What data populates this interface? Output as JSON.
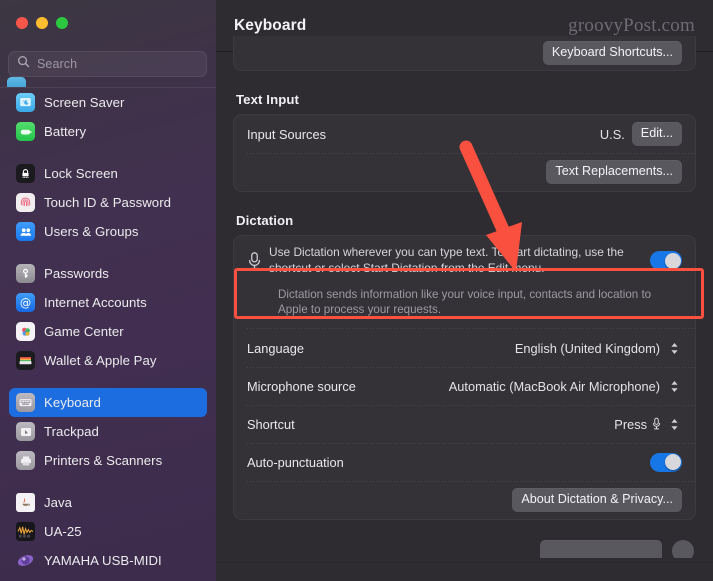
{
  "window": {
    "traffic_lights": [
      "close",
      "minimize",
      "zoom"
    ],
    "watermark": "groovyPost.com"
  },
  "sidebar": {
    "search": {
      "placeholder": "Search",
      "value": ""
    },
    "groups": [
      {
        "items": [
          {
            "label": "Screen Saver",
            "icon": "screen-saver-icon"
          },
          {
            "label": "Battery",
            "icon": "battery-icon"
          }
        ]
      },
      {
        "items": [
          {
            "label": "Lock Screen",
            "icon": "lock-screen-icon"
          },
          {
            "label": "Touch ID & Password",
            "icon": "touch-id-icon"
          },
          {
            "label": "Users & Groups",
            "icon": "users-groups-icon"
          }
        ]
      },
      {
        "items": [
          {
            "label": "Passwords",
            "icon": "passwords-icon"
          },
          {
            "label": "Internet Accounts",
            "icon": "internet-accounts-icon"
          },
          {
            "label": "Game Center",
            "icon": "game-center-icon"
          },
          {
            "label": "Wallet & Apple Pay",
            "icon": "wallet-icon"
          }
        ]
      },
      {
        "items": [
          {
            "label": "Keyboard",
            "icon": "keyboard-icon",
            "selected": true
          },
          {
            "label": "Trackpad",
            "icon": "trackpad-icon"
          },
          {
            "label": "Printers & Scanners",
            "icon": "printers-icon"
          }
        ]
      },
      {
        "items": [
          {
            "label": "Java",
            "icon": "java-icon"
          },
          {
            "label": "UA-25",
            "icon": "ua25-icon"
          },
          {
            "label": "YAMAHA USB-MIDI",
            "icon": "yamaha-icon"
          }
        ]
      }
    ]
  },
  "main": {
    "title": "Keyboard",
    "top_card": {
      "keyboard_shortcuts_button": "Keyboard Shortcuts..."
    },
    "text_input": {
      "section_title": "Text Input",
      "input_sources_label": "Input Sources",
      "input_sources_value": "U.S.",
      "edit_button": "Edit...",
      "text_replacements_button": "Text Replacements..."
    },
    "dictation": {
      "section_title": "Dictation",
      "description": "Use Dictation wherever you can type text. To start dictating, use the shortcut or select Start Dictation from the Edit menu.",
      "enabled": true,
      "privacy_note": "Dictation sends information like your voice input, contacts and location to Apple to process your requests.",
      "rows": [
        {
          "label": "Language",
          "value": "English (United Kingdom)",
          "control": "popup"
        },
        {
          "label": "Microphone source",
          "value": "Automatic (MacBook Air Microphone)",
          "control": "popup"
        },
        {
          "label": "Shortcut",
          "value": "Press",
          "control": "popup",
          "glyph": "microphone-icon"
        },
        {
          "label": "Auto-punctuation",
          "value": "",
          "control": "toggle",
          "on": true
        }
      ],
      "about_button": "About Dictation & Privacy..."
    }
  },
  "annotations": {
    "highlight_color": "#f9503f",
    "arrow_color": "#f9503f",
    "highlight_target": "dictation-enable-row",
    "arrow_points_to": "dictation-enable-row"
  }
}
